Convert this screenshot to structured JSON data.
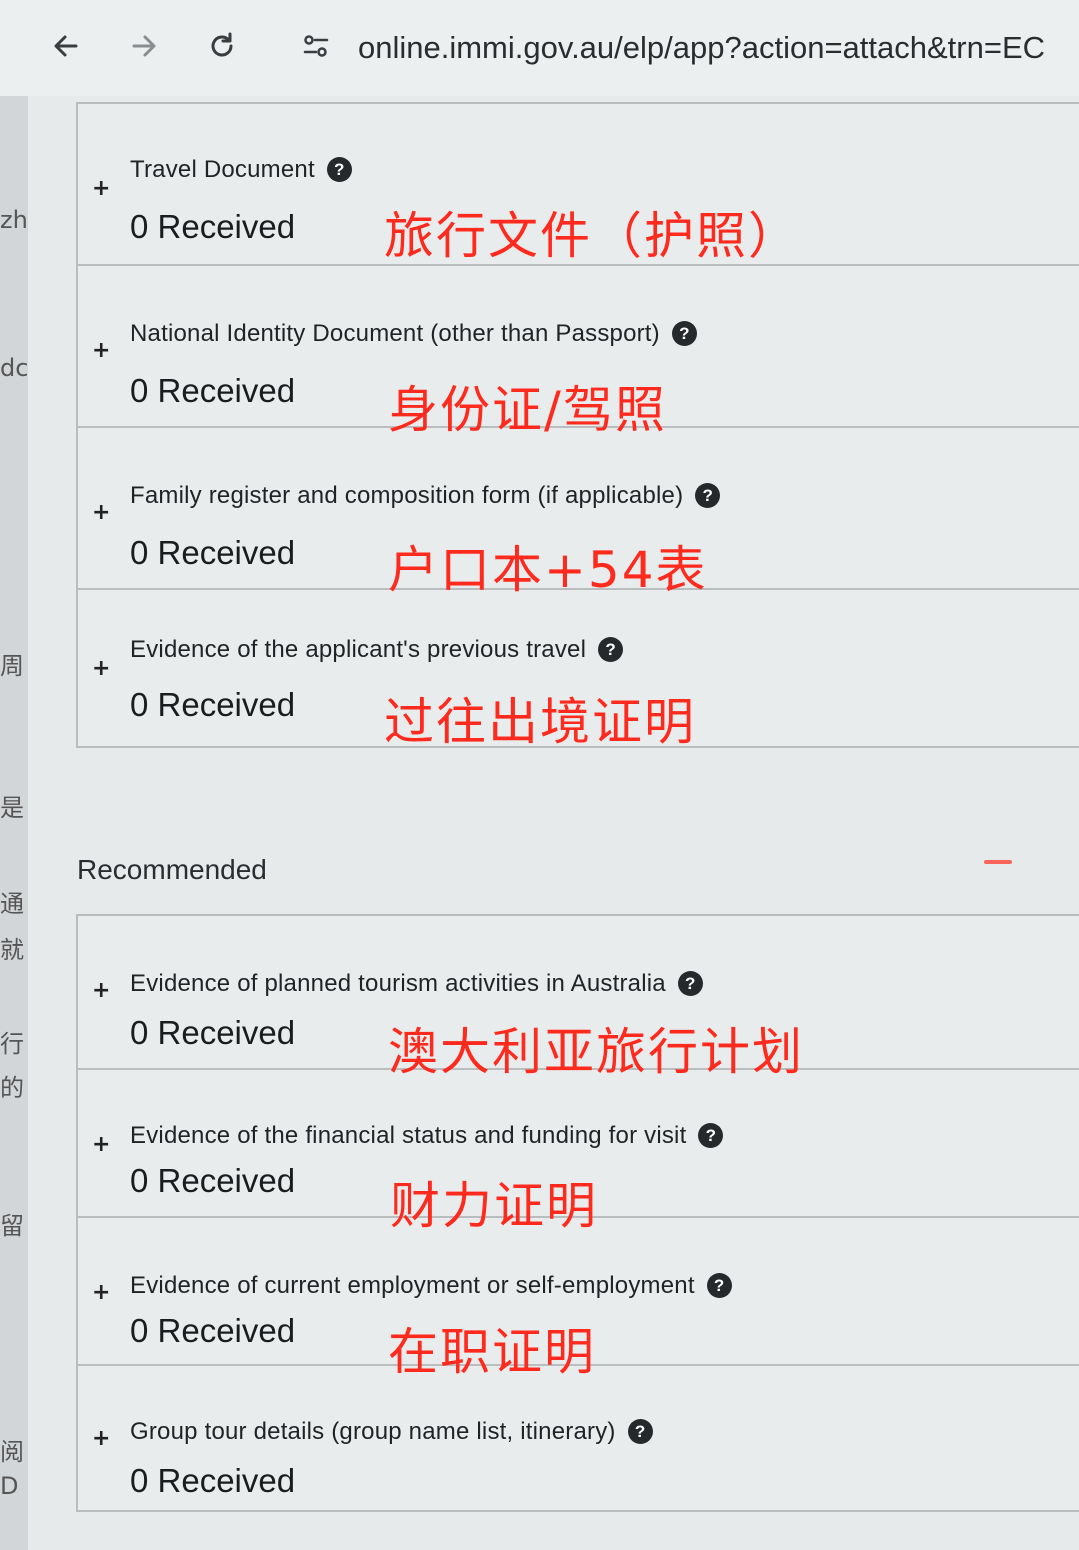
{
  "browser": {
    "url": "online.immi.gov.au/elp/app?action=attach&trn=EC"
  },
  "edge_fragments": [
    "zh",
    "dc",
    "周",
    "是",
    "通",
    "就",
    "行",
    "的",
    "留",
    "阅",
    "D"
  ],
  "required_documents": [
    {
      "title": "Travel Document",
      "status": "0 Received",
      "note": "旅行文件（护照）"
    },
    {
      "title": "National Identity Document (other than Passport)",
      "status": "0 Received",
      "note": "身份证/驾照"
    },
    {
      "title": "Family register and composition form (if applicable)",
      "status": "0 Received",
      "note": "户口本+54表"
    },
    {
      "title": "Evidence of the applicant's previous travel",
      "status": "0 Received",
      "note": "过往出境证明"
    }
  ],
  "recommended_heading": "Recommended",
  "recommended_documents": [
    {
      "title": "Evidence of planned tourism activities in Australia",
      "status": "0 Received",
      "note": "澳大利亚旅行计划"
    },
    {
      "title": "Evidence of the financial status and funding for visit",
      "status": "0 Received",
      "note": "财力证明"
    },
    {
      "title": "Evidence of current employment or self-employment",
      "status": "0 Received",
      "note": "在职证明"
    },
    {
      "title": "Group tour details (group name list, itinerary)",
      "status": "0 Received",
      "note": ""
    }
  ],
  "colors": {
    "annotation": "#ff2a1e",
    "help_icon": "#26292c"
  }
}
